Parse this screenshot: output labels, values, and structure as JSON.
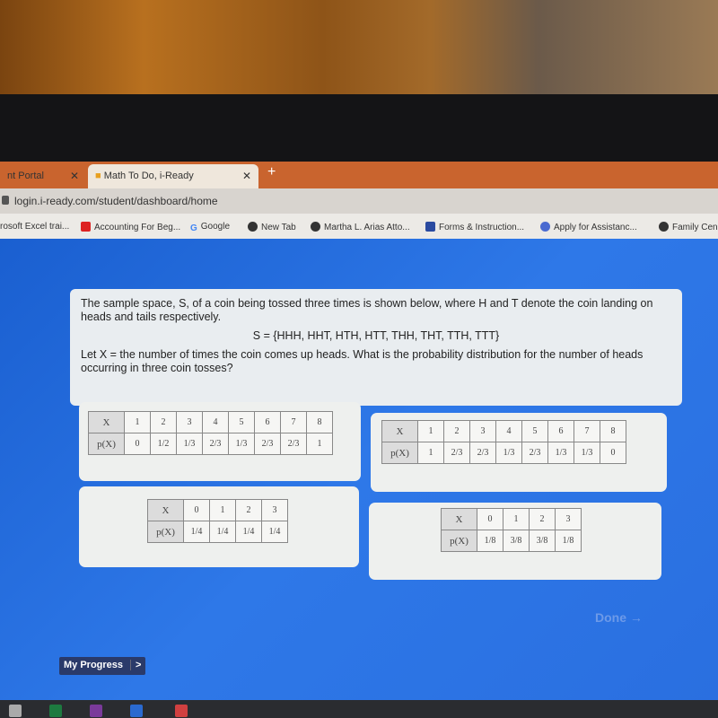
{
  "browser": {
    "tabs": [
      {
        "label": "nt Portal"
      },
      {
        "label": "Math To Do, i-Ready"
      }
    ],
    "url": "login.i-ready.com/student/dashboard/home",
    "bookmarks": [
      "rosoft Excel trai...",
      "Accounting For Beg...",
      "Google",
      "New Tab",
      "Martha L. Arias Atto...",
      "Forms & Instruction...",
      "Apply for Assistanc...",
      "Family Cen"
    ]
  },
  "question": {
    "line1": "The sample space, S, of a coin being tossed three times is shown below, where H and T denote the coin landing on heads and tails respectively.",
    "set": "S = {HHH, HHT, HTH, HTT, THH, THT, TTH, TTT}",
    "line2": "Let X = the number of times the coin comes up heads. What is the probability distribution for the number of heads occurring in three coin tosses?"
  },
  "options": [
    {
      "x_label": "X",
      "p_label": "p(X)",
      "x": [
        "1",
        "2",
        "3",
        "4",
        "5",
        "6",
        "7",
        "8"
      ],
      "p": [
        "0",
        "1/2",
        "1/3",
        "2/3",
        "1/3",
        "2/3",
        "2/3",
        "1"
      ]
    },
    {
      "x_label": "X",
      "p_label": "p(X)",
      "x": [
        "1",
        "2",
        "3",
        "4",
        "5",
        "6",
        "7",
        "8"
      ],
      "p": [
        "1",
        "2/3",
        "2/3",
        "1/3",
        "2/3",
        "1/3",
        "1/3",
        "0"
      ]
    },
    {
      "x_label": "X",
      "p_label": "p(X)",
      "x": [
        "0",
        "1",
        "2",
        "3"
      ],
      "p": [
        "1/4",
        "1/4",
        "1/4",
        "1/4"
      ]
    },
    {
      "x_label": "X",
      "p_label": "p(X)",
      "x": [
        "0",
        "1",
        "2",
        "3"
      ],
      "p": [
        "1/8",
        "3/8",
        "3/8",
        "1/8"
      ]
    }
  ],
  "done_label": "Done →",
  "progress_label": "My Progress",
  "progress_arrow": ">"
}
